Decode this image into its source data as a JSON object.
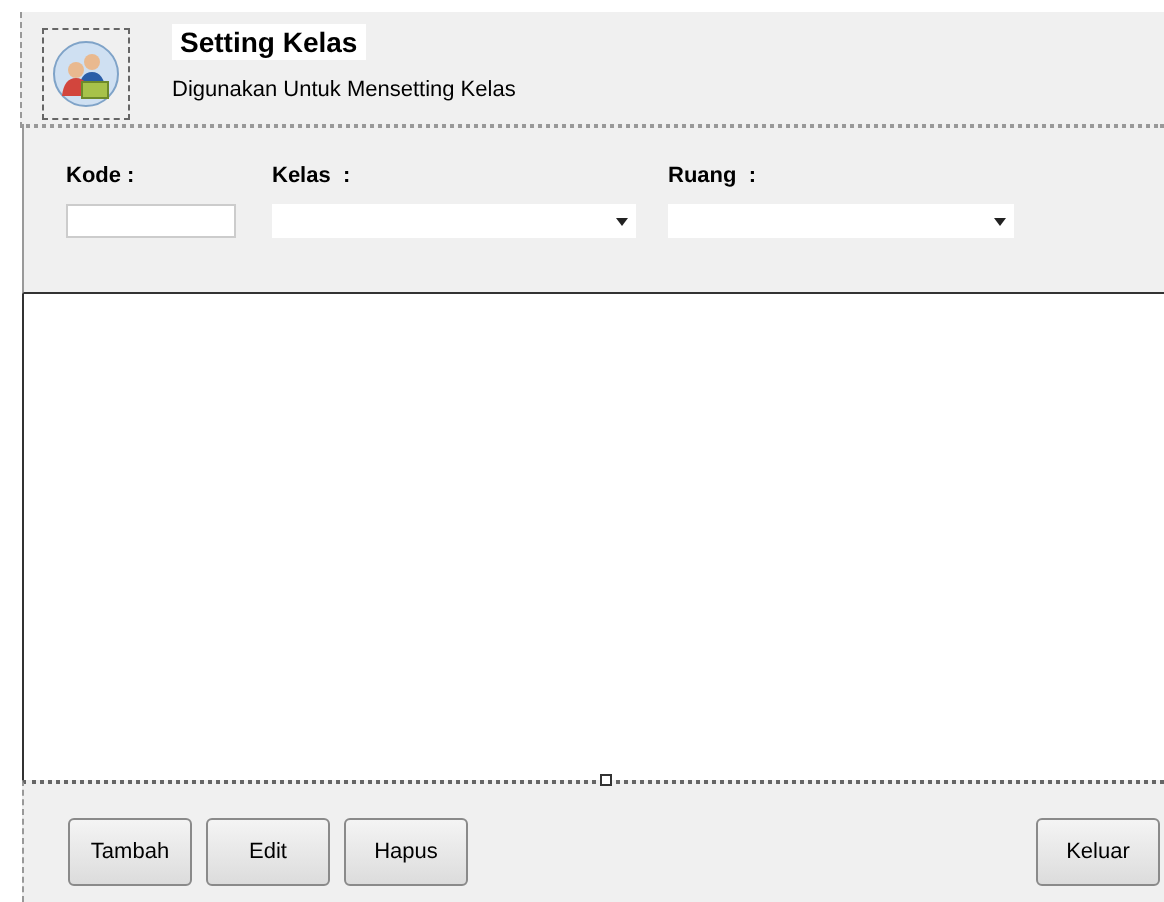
{
  "header": {
    "title": "Setting Kelas",
    "subtitle": "Digunakan Untuk Mensetting Kelas"
  },
  "filters": [
    {
      "kind": "text",
      "label": "Kode :"
    },
    {
      "kind": "combo",
      "label": "Kelas  :"
    },
    {
      "kind": "combo",
      "label": "Ruang  :"
    }
  ],
  "buttons": [
    {
      "label": "Tambah"
    },
    {
      "label": "Edit"
    },
    {
      "label": "Hapus"
    },
    {
      "label": "Keluar"
    }
  ]
}
